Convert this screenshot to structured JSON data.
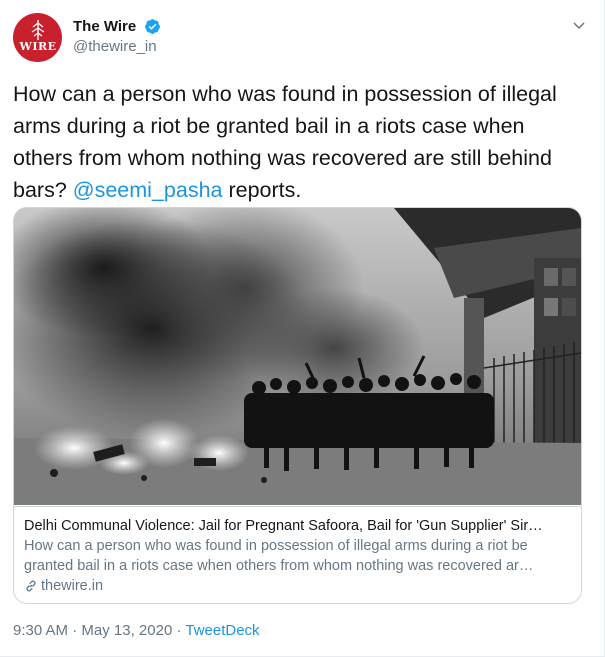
{
  "account": {
    "display_name": "The Wire",
    "handle": "@thewire_in",
    "avatar_text": "WIRE",
    "verified": true
  },
  "tweet": {
    "text_before": "How can a person who was found in possession of illegal arms during a riot be granted bail in a riots case when others from whom nothing was recovered are still behind bars? ",
    "mention": "@seemi_pasha",
    "text_after": " reports."
  },
  "card": {
    "title": "Delhi Communal Violence: Jail for Pregnant Safoora, Bail for 'Gun Supplier' Sir…",
    "description": "How can a person who was found in possession of illegal arms during a riot be granted bail in a riots case when others from whom nothing was recovered ar…",
    "domain": "thewire.in",
    "image_subject": "black-and-white photo of riot street scene with fire and smoke"
  },
  "meta": {
    "time": "9:30 AM",
    "separator1": " · ",
    "date": "May 13, 2020",
    "separator2": " · ",
    "source": "TweetDeck"
  },
  "colors": {
    "link": "#1b95e0",
    "secondary": "#657786",
    "avatar_bg": "#c8202d",
    "border": "#ccd6dd"
  },
  "icons": [
    "verified-badge-icon",
    "chevron-down-icon",
    "link-icon"
  ]
}
